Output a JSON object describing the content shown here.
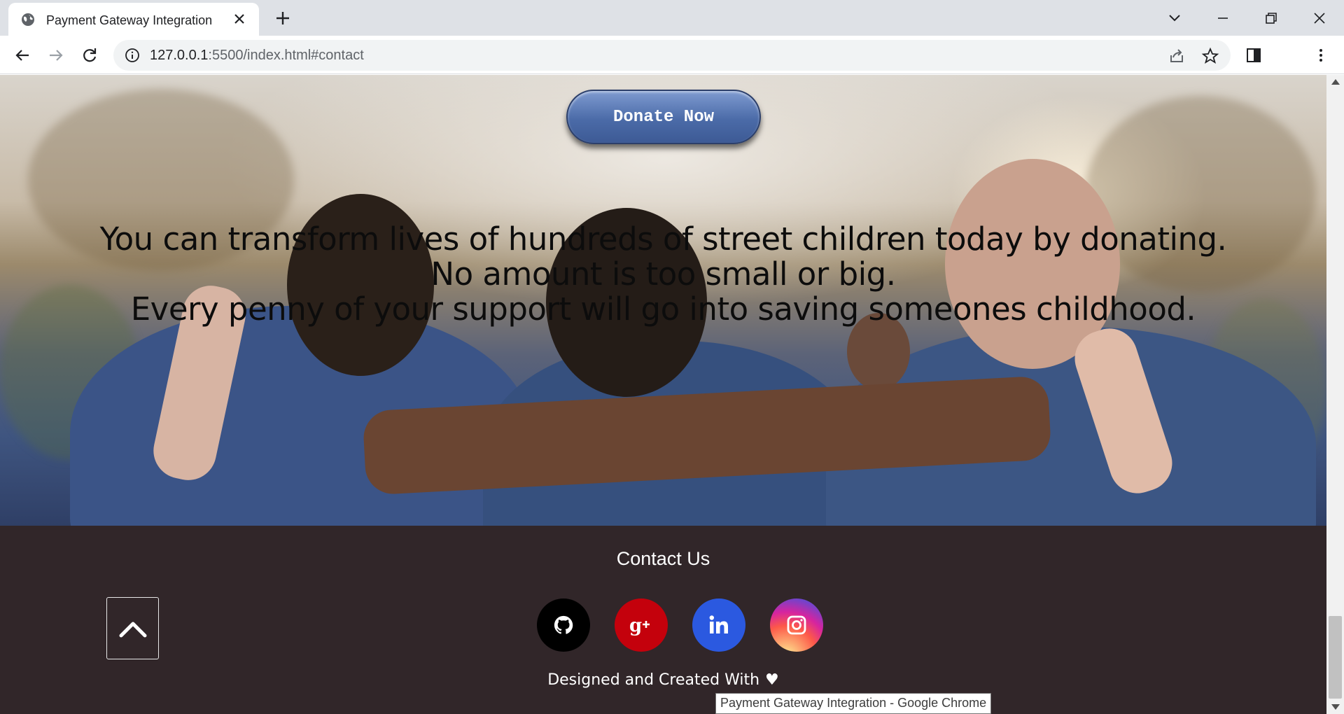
{
  "browser": {
    "tab_title": "Payment Gateway Integration",
    "url_host": "127.0.0.1",
    "url_rest": ":5500/index.html#contact",
    "tooltip": "Payment Gateway Integration - Google Chrome"
  },
  "hero": {
    "donate_label": "Donate Now",
    "message_lines": [
      "You can transform lives of hundreds of street children today by donating.",
      "No amount is too small or big.",
      "Every penny of your support will go into saving someones childhood."
    ]
  },
  "footer": {
    "contact_title": "Contact Us",
    "credit_text": "Designed and Created With",
    "social": [
      {
        "name": "github",
        "icon": "github-icon",
        "color": "#000000"
      },
      {
        "name": "google-plus",
        "icon": "google-plus-icon",
        "color": "#c4010c"
      },
      {
        "name": "linkedin",
        "icon": "linkedin-icon",
        "color": "#2b59e0"
      },
      {
        "name": "instagram",
        "icon": "instagram-icon",
        "color": "#d6249f"
      }
    ]
  },
  "colors": {
    "footer_bg": "#312629",
    "button_blue": "#4b6ba8"
  }
}
